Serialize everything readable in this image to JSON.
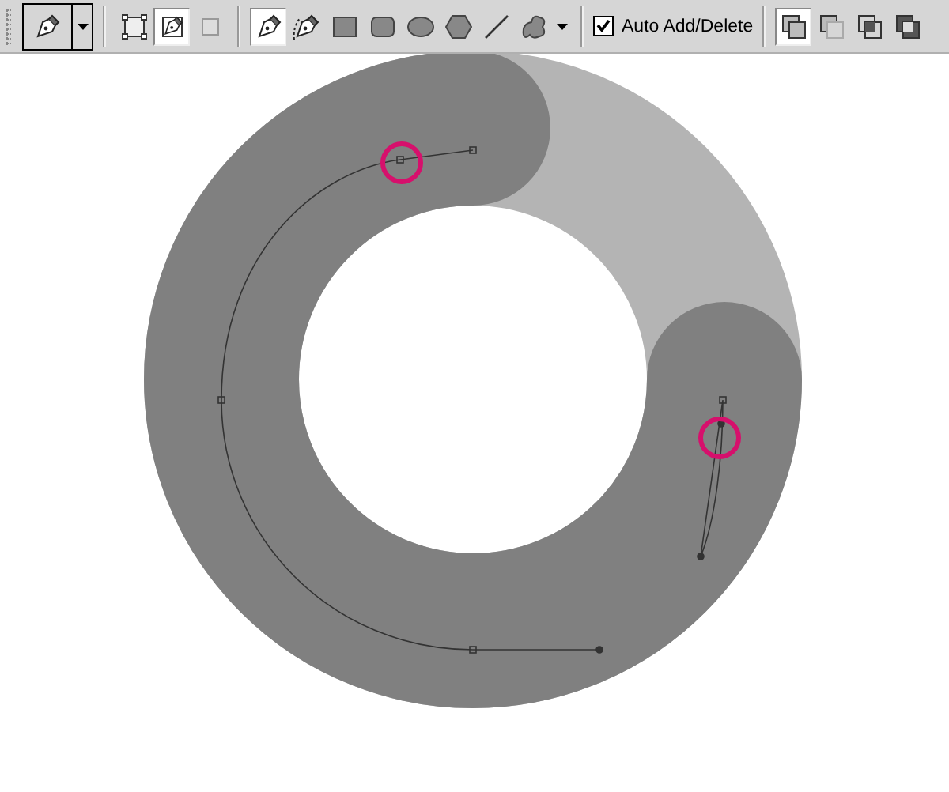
{
  "options_bar": {
    "tool_preset": {
      "kind": "pen"
    },
    "path_modes": [
      {
        "kind": "shape-layers",
        "selected": false
      },
      {
        "kind": "paths",
        "selected": true
      },
      {
        "kind": "fill-pixels",
        "selected": false
      }
    ],
    "tools": [
      {
        "kind": "pen",
        "selected": true
      },
      {
        "kind": "freeform-pen",
        "selected": false
      },
      {
        "kind": "rectangle",
        "selected": false
      },
      {
        "kind": "rounded-rectangle",
        "selected": false
      },
      {
        "kind": "ellipse",
        "selected": false
      },
      {
        "kind": "polygon",
        "selected": false
      },
      {
        "kind": "line",
        "selected": false
      },
      {
        "kind": "custom-shape",
        "selected": false
      }
    ],
    "auto_add_delete": {
      "label": "Auto Add/Delete",
      "checked": true
    },
    "combine_modes": [
      {
        "kind": "add",
        "selected": true
      },
      {
        "kind": "subtract",
        "selected": false
      },
      {
        "kind": "intersect",
        "selected": false
      },
      {
        "kind": "exclude",
        "selected": false
      }
    ]
  }
}
